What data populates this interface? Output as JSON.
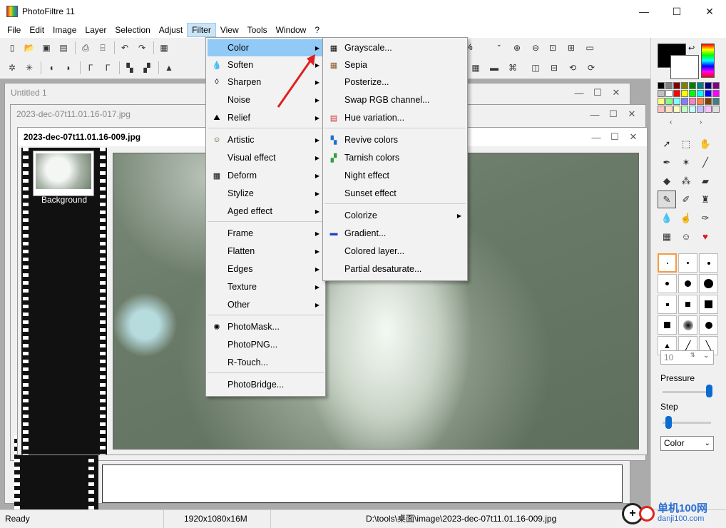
{
  "app": {
    "title": "PhotoFiltre 11"
  },
  "window_controls": {
    "minimize": "—",
    "maximize": "☐",
    "close": "✕"
  },
  "menubar": [
    "File",
    "Edit",
    "Image",
    "Layer",
    "Selection",
    "Adjust",
    "Filter",
    "View",
    "Tools",
    "Window",
    "?"
  ],
  "active_menu": "Filter",
  "toolbar_top": {
    "percent_text": "%"
  },
  "documents": [
    {
      "title": "Untitled 1"
    },
    {
      "title": "2023-dec-07t11.01.16-017.jpg"
    },
    {
      "title": "2023-dec-07t11.01.16-009.jpg"
    }
  ],
  "layers": {
    "items": [
      {
        "label": "Background"
      }
    ]
  },
  "filter_menu": [
    {
      "label": "Color",
      "icon": "",
      "submenu": true,
      "highlighted": true
    },
    {
      "label": "Soften",
      "icon": "drop-icon",
      "submenu": true
    },
    {
      "label": "Sharpen",
      "icon": "drop-outline-icon",
      "submenu": true
    },
    {
      "label": "Noise",
      "icon": "",
      "submenu": true
    },
    {
      "label": "Relief",
      "icon": "relief-icon",
      "submenu": true
    },
    {
      "label": "Artistic",
      "icon": "portrait-icon",
      "submenu": true
    },
    {
      "label": "Visual effect",
      "icon": "",
      "submenu": true
    },
    {
      "label": "Deform",
      "icon": "grid-icon",
      "submenu": true
    },
    {
      "label": "Stylize",
      "icon": "",
      "submenu": true
    },
    {
      "label": "Aged effect",
      "icon": "",
      "submenu": true
    },
    {
      "label": "Frame",
      "icon": "",
      "submenu": true
    },
    {
      "label": "Flatten",
      "icon": "",
      "submenu": true
    },
    {
      "label": "Edges",
      "icon": "",
      "submenu": true
    },
    {
      "label": "Texture",
      "icon": "",
      "submenu": true
    },
    {
      "label": "Other",
      "icon": "",
      "submenu": true
    },
    {
      "label": "PhotoMask...",
      "icon": "photomask-icon",
      "submenu": false
    },
    {
      "label": "PhotoPNG...",
      "icon": "",
      "submenu": false
    },
    {
      "label": "R-Touch...",
      "icon": "",
      "submenu": false
    },
    {
      "label": "PhotoBridge...",
      "icon": "",
      "submenu": false
    }
  ],
  "color_submenu": [
    {
      "label": "Grayscale...",
      "icon": "grayscale-icon",
      "submenu": false
    },
    {
      "label": "Sepia",
      "icon": "sepia-icon",
      "submenu": false
    },
    {
      "label": "Posterize...",
      "icon": "",
      "submenu": false
    },
    {
      "label": "Swap RGB channel...",
      "icon": "",
      "submenu": false
    },
    {
      "label": "Hue variation...",
      "icon": "hue-icon",
      "submenu": false
    },
    {
      "label": "Revive colors",
      "icon": "revive-icon",
      "submenu": false
    },
    {
      "label": "Tarnish colors",
      "icon": "tarnish-icon",
      "submenu": false
    },
    {
      "label": "Night effect",
      "icon": "",
      "submenu": false
    },
    {
      "label": "Sunset effect",
      "icon": "",
      "submenu": false
    },
    {
      "label": "Colorize",
      "icon": "",
      "submenu": true
    },
    {
      "label": "Gradient...",
      "icon": "gradient-icon",
      "submenu": false
    },
    {
      "label": "Colored layer...",
      "icon": "",
      "submenu": false
    },
    {
      "label": "Partial desaturate...",
      "icon": "",
      "submenu": false
    }
  ],
  "right_panel": {
    "foreground_color": "#000000",
    "background_color": "#ffffff",
    "palette": [
      "#000000",
      "#808080",
      "#800000",
      "#808000",
      "#008000",
      "#008080",
      "#000080",
      "#800080",
      "#c0c0c0",
      "#ffffff",
      "#ff0000",
      "#ffff00",
      "#00ff00",
      "#00ffff",
      "#0000ff",
      "#ff00ff",
      "#ffff80",
      "#80ff80",
      "#80ffff",
      "#8080ff",
      "#ff80c0",
      "#ff8040",
      "#804000",
      "#408080",
      "#ffc0c0",
      "#ffe0c0",
      "#ffffc0",
      "#c0ffc0",
      "#c0ffff",
      "#c0c0ff",
      "#ffc0ff",
      "#e0e0e0"
    ],
    "brush_size": "10",
    "pressure_label": "Pressure",
    "pressure_value": 0.95,
    "step_label": "Step",
    "step_value": 0.12,
    "mode_value": "Color"
  },
  "status": {
    "state": "Ready",
    "dimensions": "1920x1080x16M",
    "path": "D:\\tools\\桌面\\image\\2023-dec-07t11.01.16-009.jpg"
  },
  "watermark": {
    "text1": "单机100网",
    "text2": "danji100.com"
  }
}
